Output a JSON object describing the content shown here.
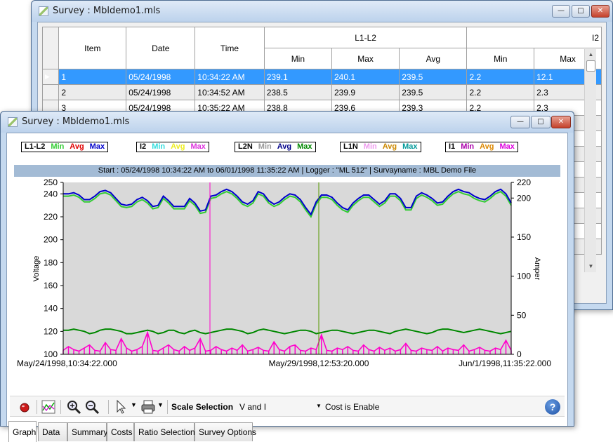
{
  "back_window": {
    "title": "Survey : Mbldemo1.mls",
    "controls": {
      "minimize": "—",
      "maximize": "□",
      "close": "✕"
    },
    "table": {
      "headers": {
        "item": "Item",
        "date": "Date",
        "time": "Time",
        "group1": "L1-L2",
        "group2": "I2",
        "min": "Min",
        "max": "Max",
        "avg": "Avg",
        "min2": "Min",
        "max2": "Max"
      },
      "rows": [
        {
          "item": "1",
          "date": "05/24/1998",
          "time": "10:34:22 AM",
          "min": "239.1",
          "max": "240.1",
          "avg": "239.5",
          "min2": "2.2",
          "max2": "12.1"
        },
        {
          "item": "2",
          "date": "05/24/1998",
          "time": "10:34:52 AM",
          "min": "238.5",
          "max": "239.9",
          "avg": "239.5",
          "min2": "2.2",
          "max2": "2.3"
        },
        {
          "item": "3",
          "date": "05/24/1998",
          "time": "10:35:22 AM",
          "min": "238.8",
          "max": "239.6",
          "avg": "239.3",
          "min2": "2.2",
          "max2": "2.3"
        }
      ]
    }
  },
  "front_window": {
    "title": "Survey : Mbldemo1.mls",
    "controls": {
      "minimize": "—",
      "maximize": "□",
      "close": "✕"
    },
    "legends": [
      {
        "name": "L1-L2",
        "items": [
          {
            "label": "Min",
            "color": "#33cc33"
          },
          {
            "label": "Avg",
            "color": "#e00000"
          },
          {
            "label": "Max",
            "color": "#0000cc"
          }
        ]
      },
      {
        "name": "I2",
        "items": [
          {
            "label": "Min",
            "color": "#33dddd"
          },
          {
            "label": "Avg",
            "color": "#eeee22"
          },
          {
            "label": "Max",
            "color": "#dd33dd"
          }
        ]
      },
      {
        "name": "L2N",
        "items": [
          {
            "label": "Min",
            "color": "#999999"
          },
          {
            "label": "Avg",
            "color": "#000088"
          },
          {
            "label": "Max",
            "color": "#008800"
          }
        ]
      },
      {
        "name": "L1N",
        "items": [
          {
            "label": "Min",
            "color": "#ee99ee"
          },
          {
            "label": "Avg",
            "color": "#cc8800"
          },
          {
            "label": "Max",
            "color": "#009999"
          }
        ]
      },
      {
        "name": "I1",
        "items": [
          {
            "label": "Min",
            "color": "#aa00aa"
          },
          {
            "label": "Avg",
            "color": "#dd8800"
          },
          {
            "label": "Max",
            "color": "#dd00dd"
          }
        ]
      }
    ],
    "info_bar": "Start : 05/24/1998  10:34:22 AM to 06/01/1998  11:35:22 AM | Logger : \"ML 512\" | Survayname : MBL Demo File",
    "toolbar": {
      "scale_label": "Scale Selection",
      "scale_value": "V and I",
      "cost_label": "Cost is Enable",
      "help": "?"
    },
    "tabs": [
      "Graph",
      "Data",
      "Summary",
      "Costs",
      "Ratio Selection",
      "Survey Options"
    ],
    "active_tab": "Graph"
  },
  "chart_data": {
    "type": "line",
    "ylabel": "Voltage",
    "y2label": "Amper",
    "ylim": [
      100,
      250
    ],
    "y2lim": [
      0,
      220
    ],
    "yticks": [
      "250",
      "240",
      "220",
      "200",
      "180",
      "160",
      "140",
      "120",
      "100"
    ],
    "y2ticks": [
      "220",
      "200",
      "150",
      "100",
      "50",
      "0"
    ],
    "xticks": [
      "May/24/1998,10:34:22.000",
      "May/29/1998,12:53:20.000",
      "Jun/1/1998,11:35:22.000"
    ],
    "plot_background": "#d9d9d9",
    "series": [
      {
        "color": "#33cc33",
        "axis": "left",
        "values": [
          238,
          238,
          239,
          237,
          233,
          233,
          236,
          240,
          241,
          239,
          234,
          229,
          228,
          229,
          233,
          235,
          232,
          227,
          228,
          236,
          232,
          227,
          227,
          227,
          234,
          230,
          223,
          224,
          236,
          237,
          240,
          242,
          240,
          236,
          231,
          229,
          232,
          240,
          238,
          232,
          229,
          231,
          235,
          238,
          237,
          233,
          226,
          220,
          231,
          237,
          237,
          235,
          230,
          226,
          224,
          230,
          234,
          237,
          237,
          233,
          229,
          232,
          238,
          238,
          234,
          226,
          226,
          236,
          239,
          237,
          234,
          230,
          231,
          236,
          240,
          242,
          240,
          239,
          236,
          234,
          233,
          236,
          240,
          242,
          238,
          230
        ]
      },
      {
        "color": "#0000cc",
        "axis": "left",
        "values": [
          240,
          240,
          241,
          239,
          235,
          235,
          238,
          242,
          243,
          241,
          236,
          231,
          230,
          231,
          235,
          237,
          234,
          229,
          230,
          238,
          234,
          229,
          229,
          229,
          236,
          232,
          225,
          226,
          238,
          239,
          242,
          244,
          242,
          238,
          233,
          231,
          234,
          242,
          240,
          234,
          231,
          233,
          237,
          240,
          239,
          235,
          228,
          222,
          233,
          239,
          239,
          237,
          232,
          228,
          226,
          232,
          236,
          239,
          239,
          235,
          231,
          234,
          240,
          240,
          236,
          228,
          228,
          238,
          241,
          239,
          236,
          232,
          233,
          238,
          242,
          244,
          242,
          241,
          238,
          236,
          235,
          238,
          242,
          244,
          240,
          232
        ]
      },
      {
        "color": "#008800",
        "axis": "left",
        "values": [
          121,
          121,
          122,
          121,
          120,
          118,
          119,
          121,
          122,
          122,
          121,
          120,
          118,
          118,
          119,
          120,
          121,
          120,
          118,
          119,
          121,
          121,
          119,
          118,
          120,
          121,
          119,
          118,
          119,
          120,
          121,
          122,
          122,
          121,
          120,
          118,
          119,
          121,
          122,
          121,
          120,
          119,
          118,
          119,
          120,
          121,
          121,
          120,
          118,
          119,
          120,
          121,
          121,
          120,
          119,
          118,
          119,
          120,
          121,
          121,
          120,
          119,
          118,
          120,
          121,
          122,
          121,
          120,
          119,
          118,
          119,
          121,
          122,
          122,
          121,
          120,
          119,
          120,
          121,
          122,
          121,
          120,
          119,
          118,
          119,
          120
        ]
      },
      {
        "color": "#ff00cc",
        "axis": "right",
        "values": [
          5,
          10,
          6,
          4,
          8,
          12,
          5,
          4,
          15,
          6,
          5,
          20,
          8,
          4,
          6,
          10,
          28,
          5,
          4,
          8,
          12,
          6,
          4,
          10,
          5,
          8,
          20,
          4,
          5,
          10,
          6,
          4,
          8,
          5,
          12,
          4,
          6,
          9,
          5,
          4,
          16,
          6,
          4,
          10,
          12,
          5,
          4,
          8,
          6,
          25,
          5,
          4,
          8,
          6,
          10,
          5,
          4,
          12,
          6,
          4,
          9,
          5,
          8,
          4,
          6,
          14,
          5,
          4,
          8,
          6,
          5,
          10,
          4,
          8,
          6,
          5,
          12,
          4,
          6,
          9,
          5,
          4,
          8,
          6,
          18,
          5
        ]
      }
    ]
  }
}
